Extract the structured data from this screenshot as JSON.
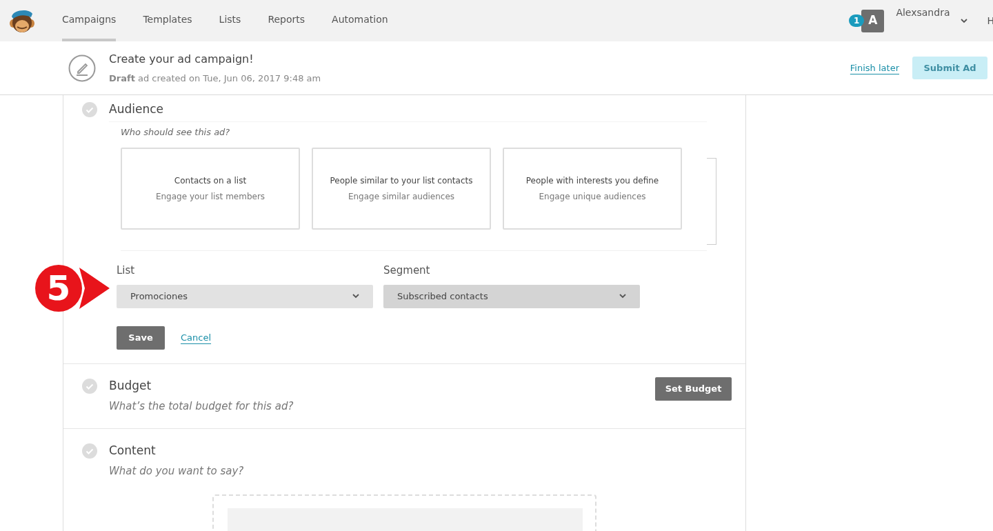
{
  "nav": {
    "tabs": [
      {
        "label": "Campaigns",
        "selected": true
      },
      {
        "label": "Templates",
        "selected": false
      },
      {
        "label": "Lists",
        "selected": false
      },
      {
        "label": "Reports",
        "selected": false
      },
      {
        "label": "Automation",
        "selected": false
      }
    ],
    "user": {
      "badge": "1",
      "avatar": "A",
      "name": "Alexsandra"
    },
    "cut_item": "H"
  },
  "header": {
    "title": "Create your ad campaign!",
    "subtitle": "**Draft** ad created on Tue, Jun 06, 2017 9:48 am",
    "finish_later": "Finish later",
    "submit": {
      "label": "Submit Ad",
      "disabled": true
    }
  },
  "audience": {
    "title": "Audience",
    "prompt": "Who should see this ad?",
    "options": [
      {
        "title": "Contacts on a list",
        "description": "Engage your list members"
      },
      {
        "title": "People similar to your list contacts",
        "description": "Engage similar audiences"
      },
      {
        "title": "People with interests you define",
        "description": "Engage unique audiences"
      }
    ],
    "fields": [
      {
        "label": "List",
        "value": "Promociones"
      },
      {
        "label": "Segment",
        "value": "Subscribed contacts"
      }
    ],
    "save": "Save",
    "cancel": "Cancel"
  },
  "sections": [
    {
      "title": "Budget",
      "prompt": "What’s the total budget for this ad?",
      "button": "Set Budget"
    },
    {
      "title": "Content",
      "prompt": "What do you want to say?"
    }
  ],
  "callout": {
    "number": "5"
  }
}
